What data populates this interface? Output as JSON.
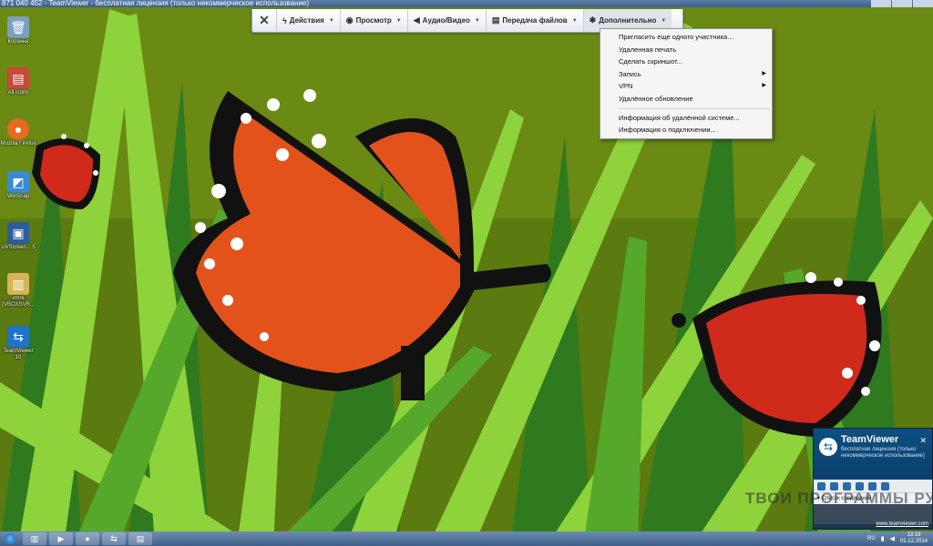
{
  "window": {
    "title": "871 040 452 - TeamViewer - бесплатная лицензия (только некоммерческое использование)"
  },
  "toolbar": {
    "close_icon": "close-icon",
    "items": [
      {
        "label": "Действия",
        "icon": "lightning-icon"
      },
      {
        "label": "Просмотр",
        "icon": "eye-icon"
      },
      {
        "label": "Аудио/Видео",
        "icon": "speaker-icon"
      },
      {
        "label": "Передача файлов",
        "icon": "file-transfer-icon"
      },
      {
        "label": "Дополнительно",
        "icon": "tools-icon"
      }
    ]
  },
  "menu": {
    "items": [
      {
        "label": "Пригласить еще одного участника...",
        "submenu": false
      },
      {
        "label": "Удаленная печать",
        "submenu": false
      },
      {
        "label": "Сделать скриншот...",
        "submenu": false
      },
      {
        "label": "Запись",
        "submenu": true
      },
      {
        "label": "VPN",
        "submenu": true
      },
      {
        "label": "Удалённое обновление",
        "submenu": false
      },
      {
        "label": "Информация об удалённой системе...",
        "submenu": false
      },
      {
        "label": "Информация о подключении...",
        "submenu": false
      }
    ]
  },
  "desktop_icons": [
    {
      "label": "Корзина",
      "icon": "recycle-bin-icon",
      "color": "#7aa0c0"
    },
    {
      "label": "All Icons",
      "icon": "folder-icon",
      "color": "#c94a3a"
    },
    {
      "label": "Mozilla Firefox",
      "icon": "firefox-icon",
      "color": "#e66b1f"
    },
    {
      "label": "WinSnap",
      "icon": "winsnap-icon",
      "color": "#3a8ad4"
    },
    {
      "label": "UVScreen... 5",
      "icon": "uvscreen-icon",
      "color": "#2d5e9c"
    },
    {
      "label": "vmrk (VBOXSVR...",
      "icon": "folder-icon",
      "color": "#d8b454"
    },
    {
      "label": "TeamViewer 10",
      "icon": "teamviewer-icon",
      "color": "#1d74c8"
    }
  ],
  "tv_panel": {
    "brand": "TeamViewer",
    "license": "бесплатная лицензия (только некоммерческое использование)",
    "connections": "Список соединений",
    "site": "www.teamviewer.com"
  },
  "watermark": "ТВОИ ПРОГРАММЫ РУ",
  "taskbar": {
    "tasks": [
      "explorer-icon",
      "media-player-icon",
      "firefox-icon",
      "teamviewer-icon",
      "folder-icon"
    ],
    "language": "RU",
    "time": "13:18",
    "date": "01.12.2014"
  },
  "colors": {
    "wallpaper_bg": "#5b7a10",
    "grass_light": "#8ed23c",
    "grass_dark": "#2f7a1e",
    "butterfly_orange": "#e4521b",
    "butterfly_red": "#cf2a1b"
  }
}
